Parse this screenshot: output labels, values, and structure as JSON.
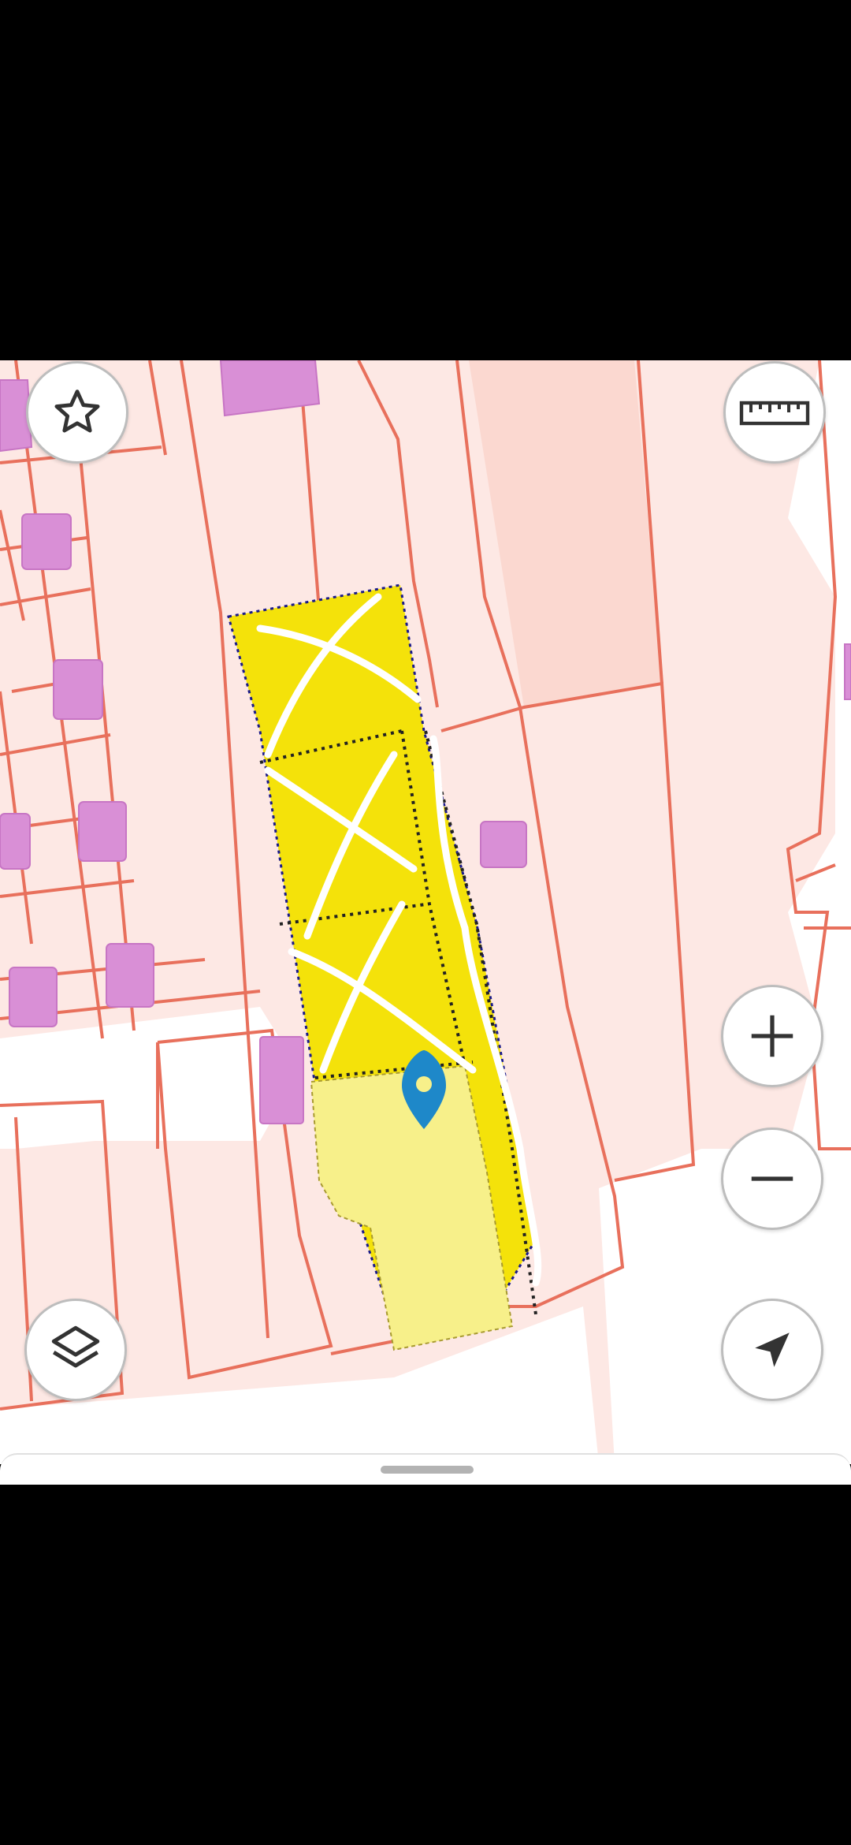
{
  "map": {
    "colors": {
      "parcel_fill": "#fde8e4",
      "parcel_border": "#e8705c",
      "building": "#d98fd6",
      "highlight": "#f4e20a",
      "highlight_light": "#f7f08a",
      "marker": "#1e88c9",
      "annotation": "#ffffff"
    }
  },
  "controls": {
    "favorite": {
      "icon": "star-icon"
    },
    "measure": {
      "icon": "ruler-icon"
    },
    "zoom_in": {
      "icon": "plus-icon"
    },
    "zoom_out": {
      "icon": "minus-icon"
    },
    "layers": {
      "icon": "layers-icon"
    },
    "locate": {
      "icon": "navigation-arrow-icon"
    }
  }
}
